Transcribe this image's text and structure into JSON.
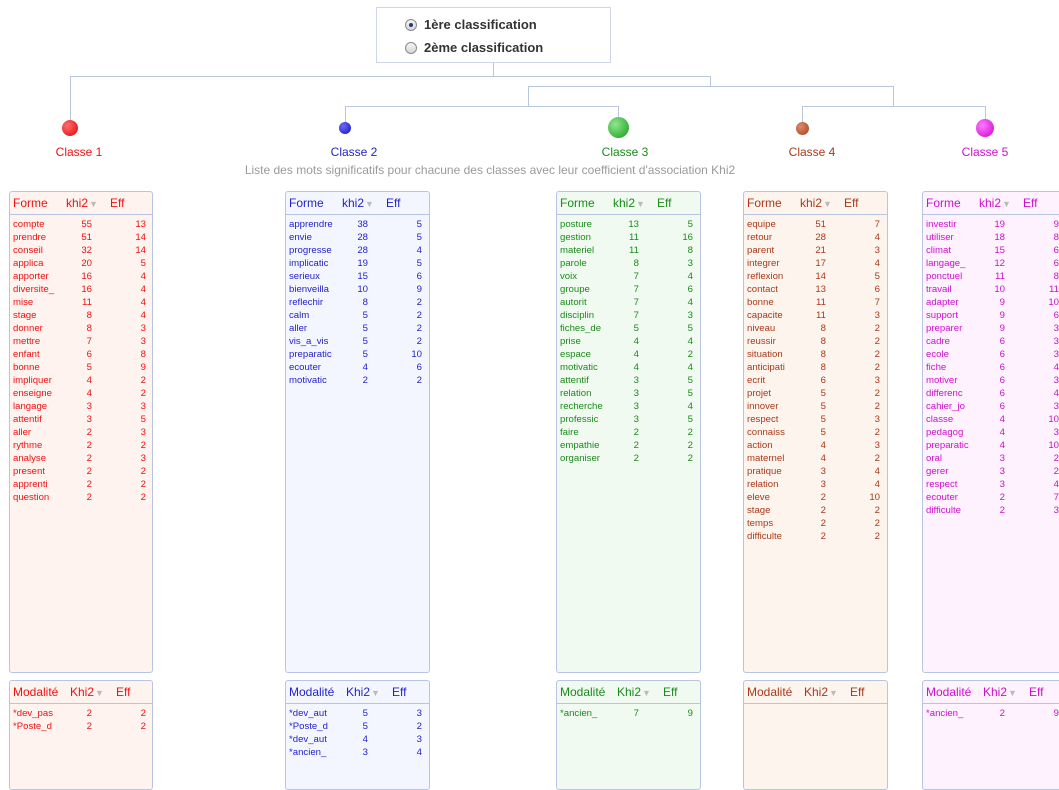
{
  "selector": {
    "options": [
      "1ère  classification",
      "2ème classification"
    ],
    "selected": 0
  },
  "subtitle": "Liste des mots significatifs pour chacune des classes avec leur coefficient d'association Khi2",
  "classes": [
    {
      "name": "Classe 1",
      "color": "#ee1111",
      "bg": "#fff3ef",
      "forme_header": [
        "Forme",
        "khi2",
        "Eff"
      ],
      "formes": [
        [
          "compte",
          "55",
          "13"
        ],
        [
          "prendre",
          "51",
          "14"
        ],
        [
          "conseil",
          "32",
          "14"
        ],
        [
          "applica",
          "20",
          "5"
        ],
        [
          "apporter",
          "16",
          "4"
        ],
        [
          "diversite_",
          "16",
          "4"
        ],
        [
          "mise",
          "11",
          "4"
        ],
        [
          "stage",
          "8",
          "4"
        ],
        [
          "donner",
          "8",
          "3"
        ],
        [
          "mettre",
          "7",
          "3"
        ],
        [
          "enfant",
          "6",
          "8"
        ],
        [
          "bonne",
          "5",
          "9"
        ],
        [
          "impliquer",
          "4",
          "2"
        ],
        [
          "enseigne",
          "4",
          "2"
        ],
        [
          "langage",
          "3",
          "3"
        ],
        [
          "attentif",
          "3",
          "5"
        ],
        [
          "aller",
          "2",
          "3"
        ],
        [
          "rythme",
          "2",
          "2"
        ],
        [
          "analyse",
          "2",
          "3"
        ],
        [
          "present",
          "2",
          "2"
        ],
        [
          "apprenti",
          "2",
          "2"
        ],
        [
          "question",
          "2",
          "2"
        ]
      ],
      "modalite_header": [
        "Modalité",
        "Khi2",
        "Eff"
      ],
      "modalites": [
        [
          "*dev_pas",
          "2",
          "2"
        ],
        [
          "*Poste_d",
          "2",
          "2"
        ]
      ]
    },
    {
      "name": "Classe 2",
      "color": "#2222cc",
      "bg": "#f4f6ff",
      "forme_header": [
        "Forme",
        "khi2",
        "Eff"
      ],
      "formes": [
        [
          "apprendre",
          "38",
          "5"
        ],
        [
          "envie",
          "28",
          "5"
        ],
        [
          "progresse",
          "28",
          "4"
        ],
        [
          "implicatic",
          "19",
          "5"
        ],
        [
          "serieux",
          "15",
          "6"
        ],
        [
          "bienveilla",
          "10",
          "9"
        ],
        [
          "reflechir",
          "8",
          "2"
        ],
        [
          "calm",
          "5",
          "2"
        ],
        [
          "aller",
          "5",
          "2"
        ],
        [
          "vis_a_vis",
          "5",
          "2"
        ],
        [
          "preparatic",
          "5",
          "10"
        ],
        [
          "ecouter",
          "4",
          "6"
        ],
        [
          "motivatic",
          "2",
          "2"
        ]
      ],
      "modalite_header": [
        "Modalité",
        "Khi2",
        "Eff"
      ],
      "modalites": [
        [
          "*dev_aut",
          "5",
          "3"
        ],
        [
          "*Poste_d",
          "5",
          "2"
        ],
        [
          "*dev_aut",
          "4",
          "3"
        ],
        [
          "*ancien_",
          "3",
          "4"
        ]
      ]
    },
    {
      "name": "Classe 3",
      "color": "#1a8a1a",
      "bg": "#f1faf1",
      "forme_header": [
        "Forme",
        "khi2",
        "Eff"
      ],
      "formes": [
        [
          "posture",
          "13",
          "5"
        ],
        [
          "gestion",
          "11",
          "16"
        ],
        [
          "materiel",
          "11",
          "8"
        ],
        [
          "parole",
          "8",
          "3"
        ],
        [
          "voix",
          "7",
          "4"
        ],
        [
          "groupe",
          "7",
          "6"
        ],
        [
          "autorit",
          "7",
          "4"
        ],
        [
          "disciplin",
          "7",
          "3"
        ],
        [
          "fiches_de",
          "5",
          "5"
        ],
        [
          "prise",
          "4",
          "4"
        ],
        [
          "espace",
          "4",
          "2"
        ],
        [
          "motivatic",
          "4",
          "4"
        ],
        [
          "attentif",
          "3",
          "5"
        ],
        [
          "relation",
          "3",
          "5"
        ],
        [
          "recherche",
          "3",
          "4"
        ],
        [
          "professic",
          "3",
          "5"
        ],
        [
          "faire",
          "2",
          "2"
        ],
        [
          "empathie",
          "2",
          "2"
        ],
        [
          "organiser",
          "2",
          "2"
        ]
      ],
      "modalite_header": [
        "Modalité",
        "Khi2",
        "Eff"
      ],
      "modalites": [
        [
          "*ancien_",
          "7",
          "9"
        ]
      ]
    },
    {
      "name": "Classe 4",
      "color": "#a83a1a",
      "bg": "#fdf4ee",
      "forme_header": [
        "Forme",
        "khi2",
        "Eff"
      ],
      "formes": [
        [
          "equipe",
          "51",
          "7"
        ],
        [
          "retour",
          "28",
          "4"
        ],
        [
          "parent",
          "21",
          "3"
        ],
        [
          "integrer",
          "17",
          "4"
        ],
        [
          "reflexion",
          "14",
          "5"
        ],
        [
          "contact",
          "13",
          "6"
        ],
        [
          "bonne",
          "11",
          "7"
        ],
        [
          "capacite",
          "11",
          "3"
        ],
        [
          "niveau",
          "8",
          "2"
        ],
        [
          "reussir",
          "8",
          "2"
        ],
        [
          "situation",
          "8",
          "2"
        ],
        [
          "anticipati",
          "8",
          "2"
        ],
        [
          "ecrit",
          "6",
          "3"
        ],
        [
          "projet",
          "5",
          "2"
        ],
        [
          "innover",
          "5",
          "2"
        ],
        [
          "respect",
          "5",
          "3"
        ],
        [
          "connaiss",
          "5",
          "2"
        ],
        [
          "action",
          "4",
          "3"
        ],
        [
          "maternel",
          "4",
          "2"
        ],
        [
          "pratique",
          "3",
          "4"
        ],
        [
          "relation",
          "3",
          "4"
        ],
        [
          "eleve",
          "2",
          "10"
        ],
        [
          "stage",
          "2",
          "2"
        ],
        [
          "temps",
          "2",
          "2"
        ],
        [
          "difficulte",
          "2",
          "2"
        ]
      ],
      "modalite_header": [
        "Modalité",
        "Khi2",
        "Eff"
      ],
      "modalites": []
    },
    {
      "name": "Classe 5",
      "color": "#cc11cc",
      "bg": "#fdf2fd",
      "forme_header": [
        "Forme",
        "khi2",
        "Eff"
      ],
      "formes": [
        [
          "investir",
          "19",
          "9"
        ],
        [
          "utiliser",
          "18",
          "8"
        ],
        [
          "climat",
          "15",
          "6"
        ],
        [
          "langage_",
          "12",
          "6"
        ],
        [
          "ponctuel",
          "11",
          "8"
        ],
        [
          "travail",
          "10",
          "11"
        ],
        [
          "adapter",
          "9",
          "10"
        ],
        [
          "support",
          "9",
          "6"
        ],
        [
          "preparer",
          "9",
          "3"
        ],
        [
          "cadre",
          "6",
          "3"
        ],
        [
          "ecole",
          "6",
          "3"
        ],
        [
          "fiche",
          "6",
          "4"
        ],
        [
          "motiver",
          "6",
          "3"
        ],
        [
          "differenc",
          "6",
          "4"
        ],
        [
          "cahier_jo",
          "6",
          "3"
        ],
        [
          "classe",
          "4",
          "10"
        ],
        [
          "pedagog",
          "4",
          "3"
        ],
        [
          "preparatic",
          "4",
          "10"
        ],
        [
          "oral",
          "3",
          "2"
        ],
        [
          "gerer",
          "3",
          "2"
        ],
        [
          "respect",
          "3",
          "4"
        ],
        [
          "ecouter",
          "2",
          "7"
        ],
        [
          "difficulte",
          "2",
          "3"
        ]
      ],
      "modalite_header": [
        "Modalité",
        "Khi2",
        "Eff"
      ],
      "modalites": [
        [
          "*ancien_",
          "2",
          "9"
        ]
      ]
    }
  ]
}
